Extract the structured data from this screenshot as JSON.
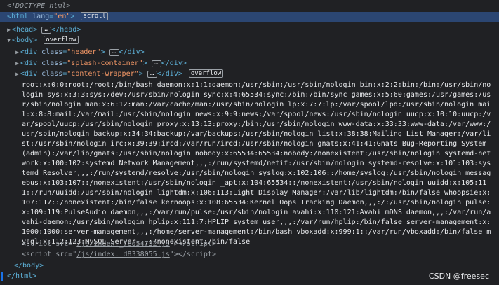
{
  "doctype": "<!DOCTYPE html>",
  "html_open": {
    "tag": "html",
    "attr": "lang",
    "value": "en",
    "badge": "scroll"
  },
  "head": {
    "tag": "head"
  },
  "body": {
    "tag": "body",
    "badge": "overflow"
  },
  "children": [
    {
      "tag": "div",
      "attr": "class",
      "value": "header"
    },
    {
      "tag": "div",
      "attr": "class",
      "value": "splash-container"
    },
    {
      "tag": "div",
      "attr": "class",
      "value": "content-wrapper",
      "badge": "overflow"
    }
  ],
  "passwd_text": "root:x:0:0:root:/root:/bin/bash daemon:x:1:1:daemon:/usr/sbin:/usr/sbin/nologin bin:x:2:2:bin:/bin:/usr/sbin/nologin sys:x:3:3:sys:/dev:/usr/sbin/nologin sync:x:4:65534:sync:/bin:/bin/sync games:x:5:60:games:/usr/games:/usr/sbin/nologin man:x:6:12:man:/var/cache/man:/usr/sbin/nologin lp:x:7:7:lp:/var/spool/lpd:/usr/sbin/nologin mail:x:8:8:mail:/var/mail:/usr/sbin/nologin news:x:9:9:news:/var/spool/news:/usr/sbin/nologin uucp:x:10:10:uucp:/var/spool/uucp:/usr/sbin/nologin proxy:x:13:13:proxy:/bin:/usr/sbin/nologin www-data:x:33:33:www-data:/var/www:/usr/sbin/nologin backup:x:34:34:backup:/var/backups:/usr/sbin/nologin list:x:38:38:Mailing List Manager:/var/list:/usr/sbin/nologin irc:x:39:39:ircd:/var/run/ircd:/usr/sbin/nologin gnats:x:41:41:Gnats Bug-Reporting System (admin):/var/lib/gnats:/usr/sbin/nologin nobody:x:65534:65534:nobody:/nonexistent:/usr/sbin/nologin systemd-network:x:100:102:systemd Network Management,,,:/run/systemd/netif:/usr/sbin/nologin systemd-resolve:x:101:103:systemd Resolver,,,:/run/systemd/resolve:/usr/sbin/nologin syslog:x:102:106::/home/syslog:/usr/sbin/nologin messagebus:x:103:107::/nonexistent:/usr/sbin/nologin _apt:x:104:65534::/nonexistent:/usr/sbin/nologin uuidd:x:105:111::/run/uuidd:/usr/sbin/nologin lightdm:x:106:113:Light Display Manager:/var/lib/lightdm:/bin/false whoopsie:x:107:117::/nonexistent:/bin/false kernoops:x:108:65534:Kernel Oops Tracking Daemon,,,:/:/usr/sbin/nologin pulse:x:109:119:PulseAudio daemon,,,:/var/run/pulse:/usr/sbin/nologin avahi:x:110:121:Avahi mDNS daemon,,,:/var/run/avahi-daemon:/usr/sbin/nologin hplip:x:111:7:HPLIP system user,,,:/var/run/hplip:/bin/false server-management:x:1000:1000:server-management,,,:/home/server-management:/bin/bash vboxadd:x:999:1::/var/run/vboxadd:/bin/false mysql:x:112:123:MySQL Server,,,:/nonexistent:/bin/false",
  "scripts": [
    {
      "tag": "script",
      "attr": "src",
      "src": "/js/index._7ed54732.js"
    },
    {
      "tag": "script",
      "attr": "src",
      "src": "/js/index._d8338055.js"
    }
  ],
  "body_close": "</body>",
  "html_close": "</html>",
  "watermark": "CSDN @freesec"
}
